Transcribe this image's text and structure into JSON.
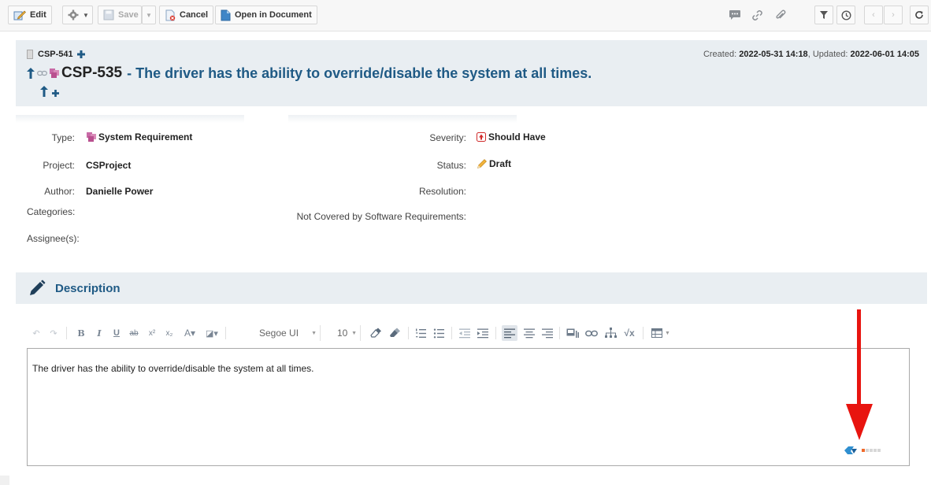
{
  "toolbar": {
    "edit_label": "Edit",
    "save_label": "Save",
    "cancel_label": "Cancel",
    "open_doc_label": "Open in Document"
  },
  "header": {
    "parent_key": "CSP-541",
    "created_label": "Created:",
    "created_value": "2022-05-31 14:18",
    "updated_label": "Updated:",
    "updated_value": "2022-06-01 14:05",
    "item_key": "CSP-535",
    "item_title": "- The driver has the ability to override/disable the system at all times."
  },
  "fields": {
    "type_label": "Type:",
    "type_value": "System Requirement",
    "project_label": "Project:",
    "project_value": "CSProject",
    "author_label": "Author:",
    "author_value": "Danielle Power",
    "categories_label": "Categories:",
    "assignees_label": "Assignee(s):",
    "severity_label": "Severity:",
    "severity_value": "Should Have",
    "status_label": "Status:",
    "status_value": "Draft",
    "resolution_label": "Resolution:",
    "not_covered_label": "Not Covered by Software Requirements:"
  },
  "description": {
    "title": "Description",
    "font_name": "Segoe UI",
    "font_size": "10",
    "body_text": "The driver has the ability to override/disable the system at all times."
  },
  "colors": {
    "accent_blue": "#1f5a85",
    "header_bg": "#e9eef2",
    "arrow_red": "#e8140f"
  }
}
